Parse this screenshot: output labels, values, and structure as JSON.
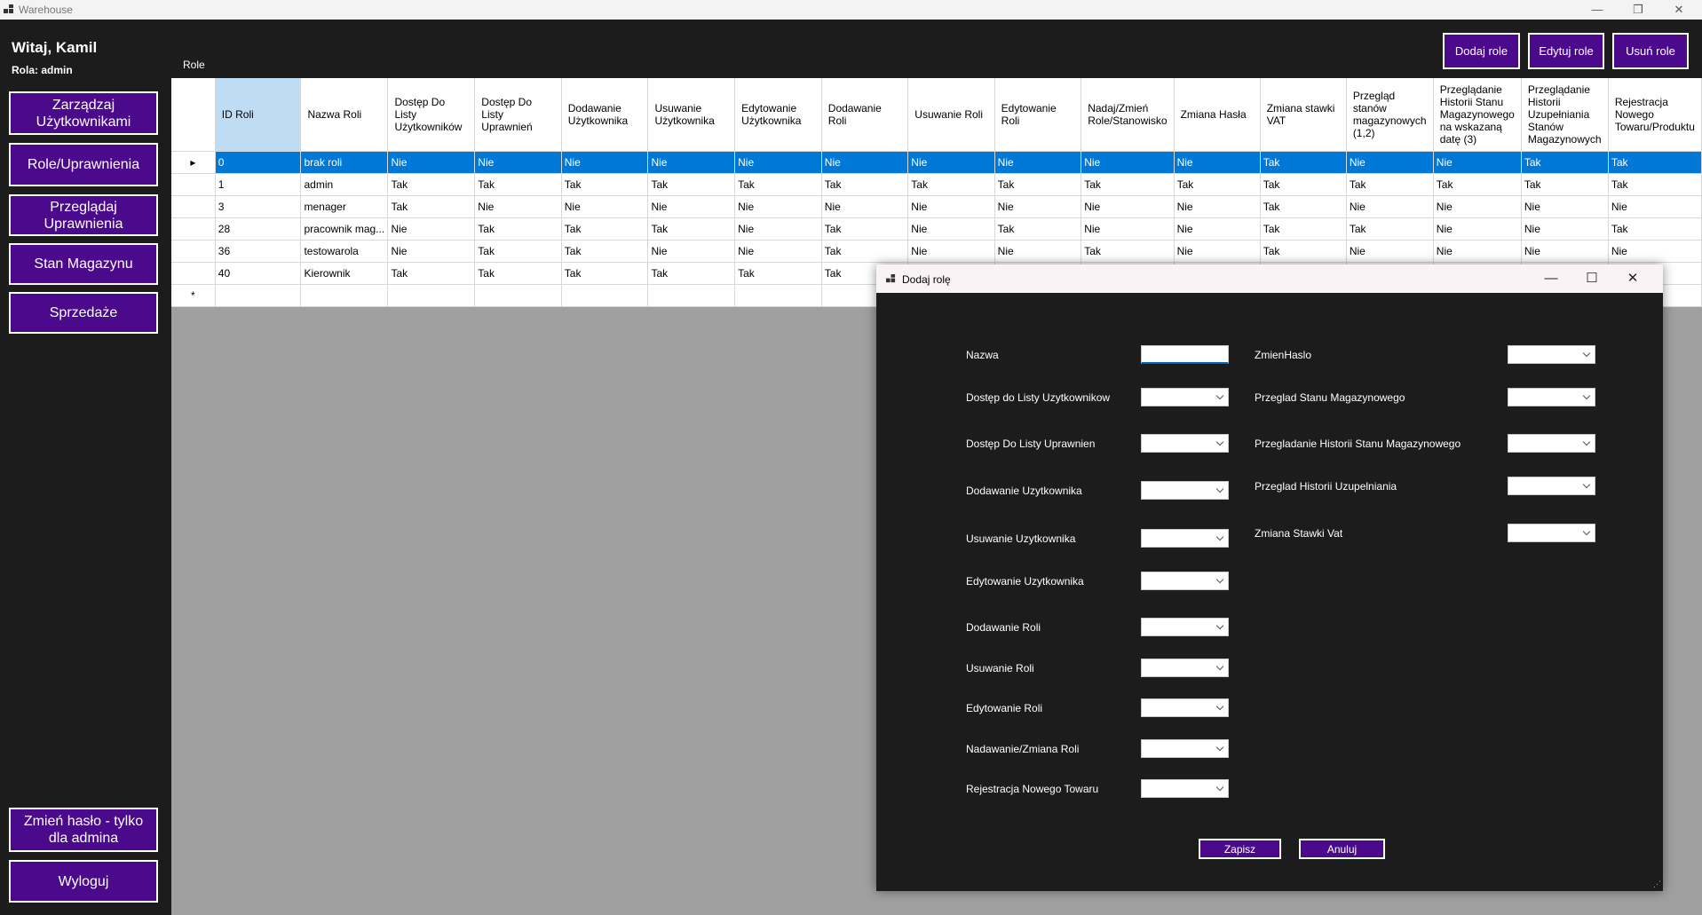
{
  "window": {
    "title": "Warehouse",
    "minimize": "—",
    "maximize": "❐",
    "close": "✕"
  },
  "sidebar": {
    "welcome": "Witaj, Kamil",
    "role": "Rola: admin",
    "items": [
      {
        "label": "Zarządzaj Użytkownikami"
      },
      {
        "label": "Role/Uprawnienia"
      },
      {
        "label": "Przeglądaj Uprawnienia"
      },
      {
        "label": "Stan Magazynu"
      },
      {
        "label": "Sprzedaże"
      }
    ],
    "change_password": "Zmień hasło - tylko dla admina",
    "logout": "Wyloguj"
  },
  "toolbar": {
    "caption": "Role",
    "add": "Dodaj role",
    "edit": "Edytuj role",
    "delete": "Usuń role"
  },
  "grid": {
    "columns": [
      "ID Roli",
      "Nazwa Roli",
      "Dostęp Do Listy Użytkowników",
      "Dostęp Do Listy Uprawnień",
      "Dodawanie Użytkownika",
      "Usuwanie Użytkownika",
      "Edytowanie Użytkownika",
      "Dodawanie Roli",
      "Usuwanie Roli",
      "Edytowanie Roli",
      "Nadaj/Zmień Role/Stanowisko",
      "Zmiana Hasła",
      "Zmiana stawki VAT",
      "Przegląd stanów magazynowych (1,2)",
      "Przeglądanie Historii Stanu Magazynowego na wskazaną datę (3)",
      "Przeglądanie Historii Uzupełniania Stanów Magazynowych",
      "Rejestracja Nowego Towaru/Produktu"
    ],
    "rows": [
      [
        "0",
        "brak roli",
        "Nie",
        "Nie",
        "Nie",
        "Nie",
        "Nie",
        "Nie",
        "Nie",
        "Nie",
        "Nie",
        "Nie",
        "Tak",
        "Nie",
        "Nie",
        "Tak",
        "Tak"
      ],
      [
        "1",
        "admin",
        "Tak",
        "Tak",
        "Tak",
        "Tak",
        "Tak",
        "Tak",
        "Tak",
        "Tak",
        "Tak",
        "Tak",
        "Tak",
        "Tak",
        "Tak",
        "Tak",
        "Tak"
      ],
      [
        "3",
        "menager",
        "Tak",
        "Nie",
        "Nie",
        "Nie",
        "Nie",
        "Nie",
        "Nie",
        "Nie",
        "Nie",
        "Nie",
        "Tak",
        "Nie",
        "Nie",
        "Nie",
        "Nie"
      ],
      [
        "28",
        "pracownik mag...",
        "Nie",
        "Tak",
        "Tak",
        "Tak",
        "Nie",
        "Tak",
        "Nie",
        "Tak",
        "Nie",
        "Nie",
        "Tak",
        "Tak",
        "Nie",
        "Nie",
        "Tak"
      ],
      [
        "36",
        "testowarola",
        "Nie",
        "Tak",
        "Tak",
        "Nie",
        "Nie",
        "Tak",
        "Nie",
        "Nie",
        "Tak",
        "Nie",
        "Tak",
        "Nie",
        "Nie",
        "Nie",
        "Nie"
      ],
      [
        "40",
        "Kierownik",
        "Tak",
        "Tak",
        "Tak",
        "Tak",
        "Tak",
        "Tak",
        "",
        "",
        "",
        "",
        "",
        "",
        "",
        "",
        ""
      ]
    ],
    "selected_row": 0,
    "new_row_marker": "*",
    "current_row_marker": "▸"
  },
  "dialog": {
    "title": "Dodaj rolę",
    "minimize": "—",
    "maximize": "☐",
    "close": "✕",
    "left_fields": [
      {
        "label": "Nazwa",
        "type": "text",
        "value": ""
      },
      {
        "label": "Dostęp do Listy Uzytkownikow",
        "type": "combo",
        "value": ""
      },
      {
        "label": "Dostęp Do Listy Uprawnien",
        "type": "combo",
        "value": ""
      },
      {
        "label": "Dodawanie Uzytkownika",
        "type": "combo",
        "value": ""
      },
      {
        "label": "Usuwanie Uzytkownika",
        "type": "combo",
        "value": ""
      },
      {
        "label": "Edytowanie Uzytkownika",
        "type": "combo",
        "value": ""
      },
      {
        "label": "Dodawanie Roli",
        "type": "combo",
        "value": ""
      },
      {
        "label": "Usuwanie Roli",
        "type": "combo",
        "value": ""
      },
      {
        "label": "Edytowanie Roli",
        "type": "combo",
        "value": ""
      },
      {
        "label": "Nadawanie/Zmiana Roli",
        "type": "combo",
        "value": ""
      },
      {
        "label": "Rejestracja Nowego Towaru",
        "type": "combo",
        "value": ""
      }
    ],
    "right_fields": [
      {
        "label": "ZmienHaslo",
        "type": "combo",
        "value": ""
      },
      {
        "label": "Przeglad Stanu Magazynowego",
        "type": "combo",
        "value": ""
      },
      {
        "label": "Przegladanie Historii Stanu Magazynowego",
        "type": "combo",
        "value": ""
      },
      {
        "label": "Przeglad Historii Uzupelniania",
        "type": "combo",
        "value": ""
      },
      {
        "label": "Zmiana Stawki Vat",
        "type": "combo",
        "value": ""
      }
    ],
    "save": "Zapisz",
    "cancel": "Anuluj"
  },
  "colors": {
    "button_purple": "#4b0a8c",
    "selection_blue": "#0078d7",
    "header_selected": "#bfdcf5",
    "dark_bg": "#1c1c1c",
    "grid_bg": "#a0a0a0"
  }
}
